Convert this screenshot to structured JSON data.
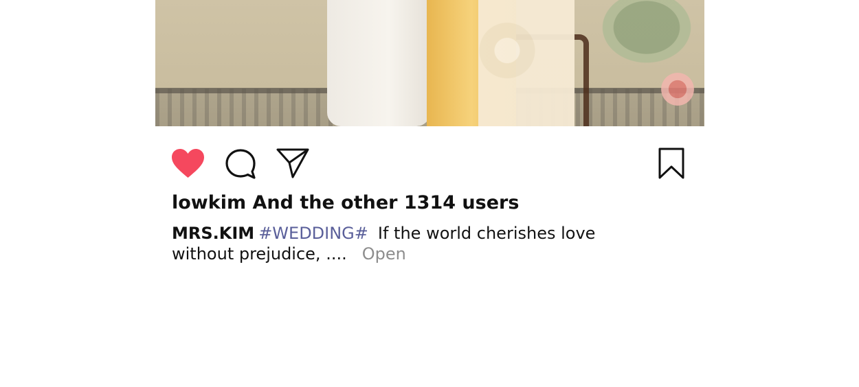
{
  "post": {
    "image_alt": "Wedding couple photo"
  },
  "actions": {
    "like_icon": "heart-filled-icon",
    "comment_icon": "comment-bubble-icon",
    "share_icon": "send-paper-plane-icon",
    "save_icon": "bookmark-icon",
    "like_color": "#f5485e"
  },
  "likes": {
    "text": "lowkim And the other 1314 users"
  },
  "caption": {
    "username": "MRS.KIM",
    "hashtag": "#WEDDING#",
    "text": "If the world cherishes love without prejudice, ....",
    "more_label": "Open"
  }
}
